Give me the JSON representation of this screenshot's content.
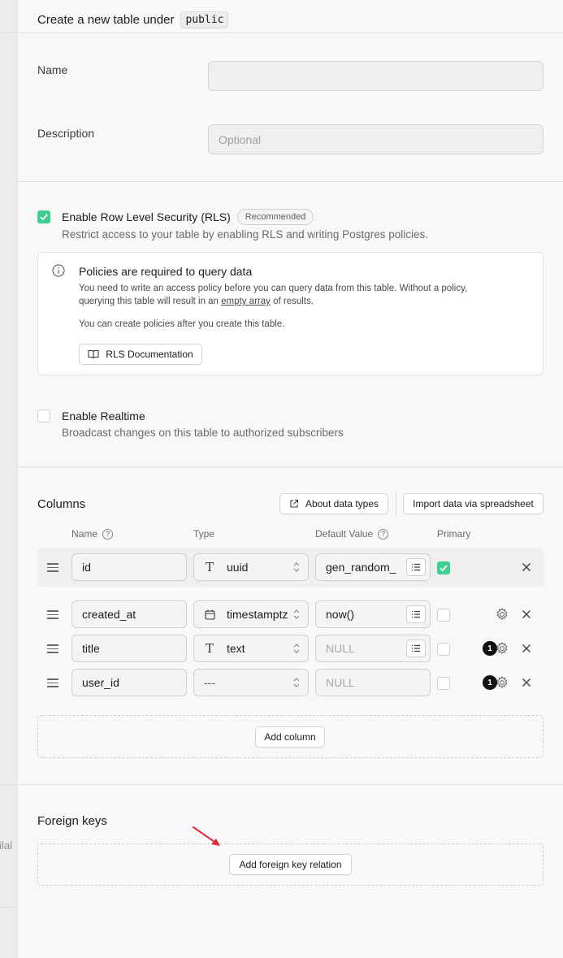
{
  "header": {
    "title": "Create a new table under",
    "schema": "public"
  },
  "name_field": {
    "label": "Name",
    "value": ""
  },
  "description_field": {
    "label": "Description",
    "placeholder": "Optional"
  },
  "rls": {
    "label": "Enable Row Level Security (RLS)",
    "badge": "Recommended",
    "help": "Restrict access to your table by enabling RLS and writing Postgres policies.",
    "checked": true
  },
  "policy_callout": {
    "title": "Policies are required to query data",
    "line1": "You need to write an access policy before you can query data from this table. Without a policy,",
    "line2_before": "querying this table will result in an",
    "line2_link": "empty array",
    "line2_after": "of results.",
    "line3": "You can create policies after you create this table.",
    "doc_button": "RLS Documentation"
  },
  "realtime": {
    "label": "Enable Realtime",
    "help": "Broadcast changes on this table to authorized subscribers",
    "checked": false
  },
  "columns": {
    "title": "Columns",
    "about_button": "About data types",
    "import_button": "Import data via spreadsheet",
    "headers": {
      "name": "Name",
      "type": "Type",
      "default": "Default Value",
      "primary": "Primary"
    },
    "rows": [
      {
        "name": "id",
        "type": "uuid",
        "default": "gen_random_",
        "primary": true
      },
      {
        "name": "created_at",
        "type": "timestamptz",
        "default": "now()",
        "primary": false
      },
      {
        "name": "title",
        "type": "text",
        "default": "NULL",
        "primary": false,
        "badge": "1"
      },
      {
        "name": "user_id",
        "type": "---",
        "default": "NULL",
        "primary": false,
        "badge": "1"
      }
    ],
    "add_button": "Add column"
  },
  "foreign_keys": {
    "title": "Foreign keys",
    "add_button": "Add foreign key relation"
  },
  "backdrop": {
    "peek_text": "ailal"
  },
  "colors": {
    "accent": "#3ecf8e",
    "annotation_arrow": "#e5283a"
  },
  "icons": [
    "info-icon",
    "book-icon",
    "external-link-icon",
    "help-circle-icon",
    "drag-handle-icon",
    "text-type-icon",
    "calendar-icon",
    "chevron-updown-icon",
    "list-icon",
    "settings-gear-icon",
    "close-icon",
    "check-icon"
  ]
}
